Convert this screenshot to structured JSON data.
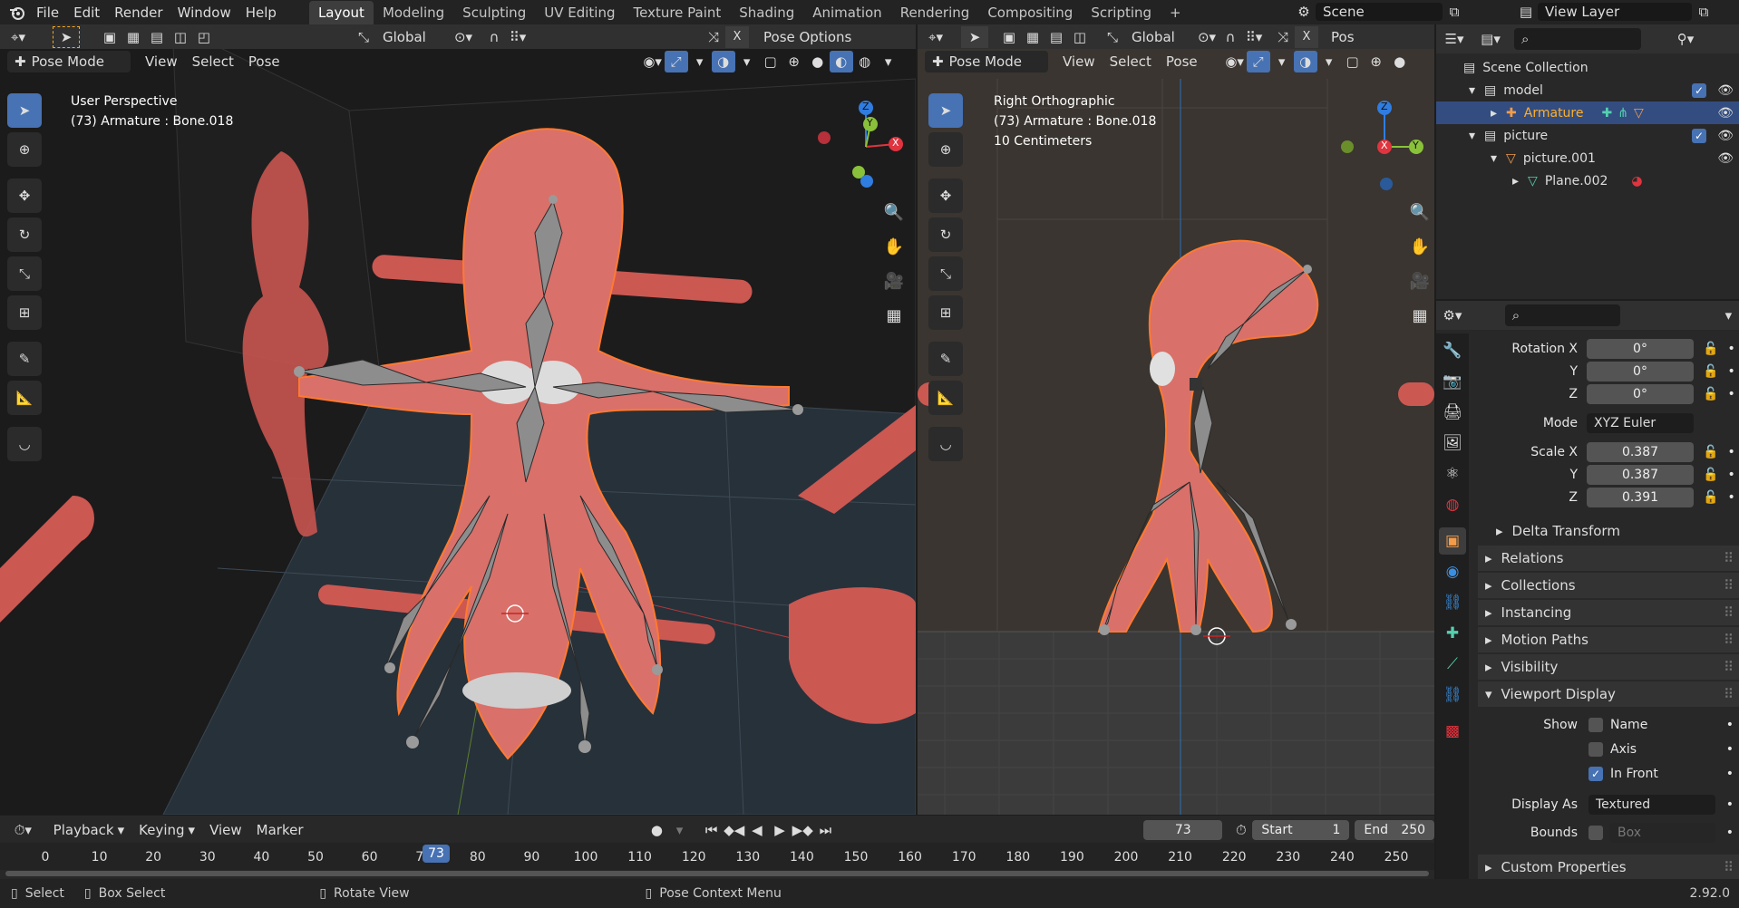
{
  "topbar": {
    "menus": [
      "File",
      "Edit",
      "Render",
      "Window",
      "Help"
    ],
    "workspaces": [
      "Layout",
      "Modeling",
      "Sculpting",
      "UV Editing",
      "Texture Paint",
      "Shading",
      "Animation",
      "Rendering",
      "Compositing",
      "Scripting"
    ],
    "active_workspace": "Layout",
    "add_tab": "+",
    "scene": "Scene",
    "view_layer": "View Layer"
  },
  "left_view": {
    "orientation": "Global",
    "pose_options": "Pose Options",
    "mode": "Pose Mode",
    "menus": [
      "View",
      "Select",
      "Pose"
    ],
    "title": "User Perspective",
    "subtitle": "(73) Armature : Bone.018",
    "axes": {
      "z": "Z",
      "y": "Y",
      "x": "X"
    }
  },
  "right_view": {
    "orientation": "Global",
    "pose_options": "Pos",
    "mode": "Pose Mode",
    "menus": [
      "View",
      "Select",
      "Pose"
    ],
    "title": "Right Orthographic",
    "subtitle": "(73) Armature : Bone.018",
    "scale_text": "10 Centimeters",
    "axes": {
      "z": "Z",
      "y": "Y",
      "x": "X"
    }
  },
  "outliner": {
    "rows": [
      {
        "label": "Scene Collection",
        "indent": 0
      },
      {
        "label": "model",
        "indent": 1,
        "checked": true
      },
      {
        "label": "Armature",
        "indent": 2,
        "selected": true
      },
      {
        "label": "picture",
        "indent": 1,
        "checked": true
      },
      {
        "label": "picture.001",
        "indent": 2
      },
      {
        "label": "Plane.002",
        "indent": 3
      }
    ]
  },
  "properties": {
    "rotation": {
      "label_x": "Rotation X",
      "label_y": "Y",
      "label_z": "Z",
      "x": "0°",
      "y": "0°",
      "z": "0°"
    },
    "mode_label": "Mode",
    "mode_value": "XYZ Euler",
    "scale": {
      "label_x": "Scale X",
      "label_y": "Y",
      "label_z": "Z",
      "x": "0.387",
      "y": "0.387",
      "z": "0.391"
    },
    "delta_transform": "Delta Transform",
    "sections": [
      "Relations",
      "Collections",
      "Instancing",
      "Motion Paths",
      "Visibility"
    ],
    "viewport_display": "Viewport Display",
    "show_label": "Show",
    "show_name": "Name",
    "show_axis": "Axis",
    "show_in_front": "In Front",
    "display_as_label": "Display As",
    "display_as_value": "Textured",
    "bounds_label": "Bounds",
    "bounds_value": "Box",
    "custom_properties": "Custom Properties"
  },
  "timeline": {
    "menus": [
      "Playback",
      "Keying",
      "View",
      "Marker"
    ],
    "current_frame": "73",
    "start_label": "Start",
    "start": "1",
    "end_label": "End",
    "end": "250",
    "ticks": [
      "0",
      "10",
      "20",
      "30",
      "40",
      "50",
      "60",
      "70",
      "80",
      "90",
      "100",
      "110",
      "120",
      "130",
      "140",
      "150",
      "160",
      "170",
      "180",
      "190",
      "200",
      "210",
      "220",
      "230",
      "240",
      "250"
    ],
    "playhead": "73"
  },
  "statusbar": {
    "select": "Select",
    "box_select": "Box Select",
    "rotate_view": "Rotate View",
    "context_menu": "Pose Context Menu",
    "version": "2.92.0"
  },
  "colors": {
    "accent": "#4772b3",
    "model": "#d9706a",
    "bg_left": "#1b1b1b",
    "bg_right": "#3a3530",
    "x_axis": "#e0343f",
    "y_axis": "#8ac13a",
    "z_axis": "#2f7de1"
  }
}
